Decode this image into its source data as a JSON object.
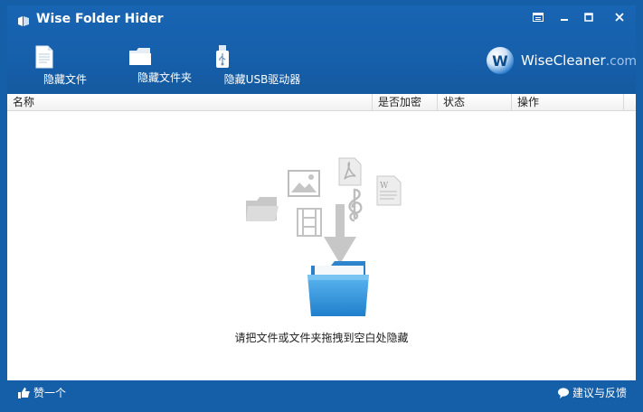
{
  "window": {
    "title": "Wise Folder Hider"
  },
  "toolbar": [
    {
      "label": "隐藏文件",
      "icon": "file-icon"
    },
    {
      "label": "隐藏文件夹",
      "icon": "folder-icon"
    },
    {
      "label": "隐藏USB驱动器",
      "icon": "usb-icon"
    }
  ],
  "brand": {
    "logo_letter": "W",
    "name": "WiseCleaner",
    "suffix": ".com"
  },
  "table": {
    "columns": [
      "名称",
      "是否加密",
      "状态",
      "操作"
    ]
  },
  "empty_state": {
    "hint": "请把文件或文件夹拖拽到空白处隐藏"
  },
  "footer": {
    "like_label": "赞一个",
    "feedback_label": "建议与反馈"
  },
  "colors": {
    "frame": "#155ea8",
    "folder_blue": "#2b8fd9"
  }
}
